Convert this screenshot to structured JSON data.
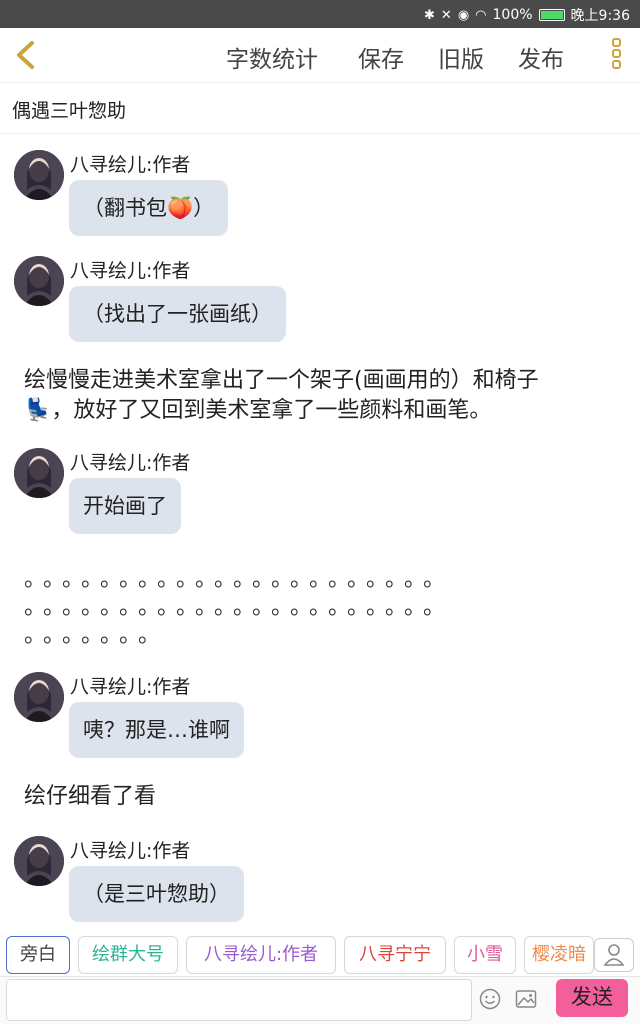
{
  "status": {
    "battery": "100%",
    "time": "晚上9:36"
  },
  "toolbar": {
    "items": [
      "字数统计",
      "保存",
      "旧版",
      "发布"
    ]
  },
  "title": "偶遇三叶惣助",
  "messages": [
    {
      "author": "八寻绘儿:作者",
      "text": "（翻书包🍑）"
    },
    {
      "author": "八寻绘儿:作者",
      "text": "（找出了一张画纸）"
    },
    {
      "narration_l1": "绘慢慢走进美术室拿出了一个架子(画画用的）和椅子",
      "narration_l2": "💺，放好了又回到美术室拿了一些颜料和画笔。"
    },
    {
      "author": "八寻绘儿:作者",
      "text": "开始画了"
    },
    {
      "dots_line1": "。。。。。。。。。。。。。。。。。。。。。。",
      "dots_line2": "。。。。。。。。。。。。。。。。。。。。。。",
      "dots_line3": "。。。。。。。"
    },
    {
      "author": "八寻绘儿:作者",
      "text": "咦？那是…谁啊"
    },
    {
      "narration": "绘仔细看了看"
    },
    {
      "author": "八寻绘儿:作者",
      "text": "（是三叶惣助）"
    }
  ],
  "roles": [
    "旁白",
    "绘群大号",
    "八寻绘儿:作者",
    "八寻宁宁",
    "小雪",
    "樱凌暗"
  ],
  "role_colors": [
    "#444444",
    "#2bb39a",
    "#9b59d0",
    "#d9453b",
    "#e05a9a",
    "#f08a4b"
  ],
  "input": {
    "placeholder": "",
    "value": ""
  },
  "send_label": "发送",
  "icons": {
    "back": "chevron-left-icon",
    "menu": "more-menu-icon",
    "emoji": "emoji-icon",
    "image": "image-icon",
    "person": "person-icon"
  }
}
